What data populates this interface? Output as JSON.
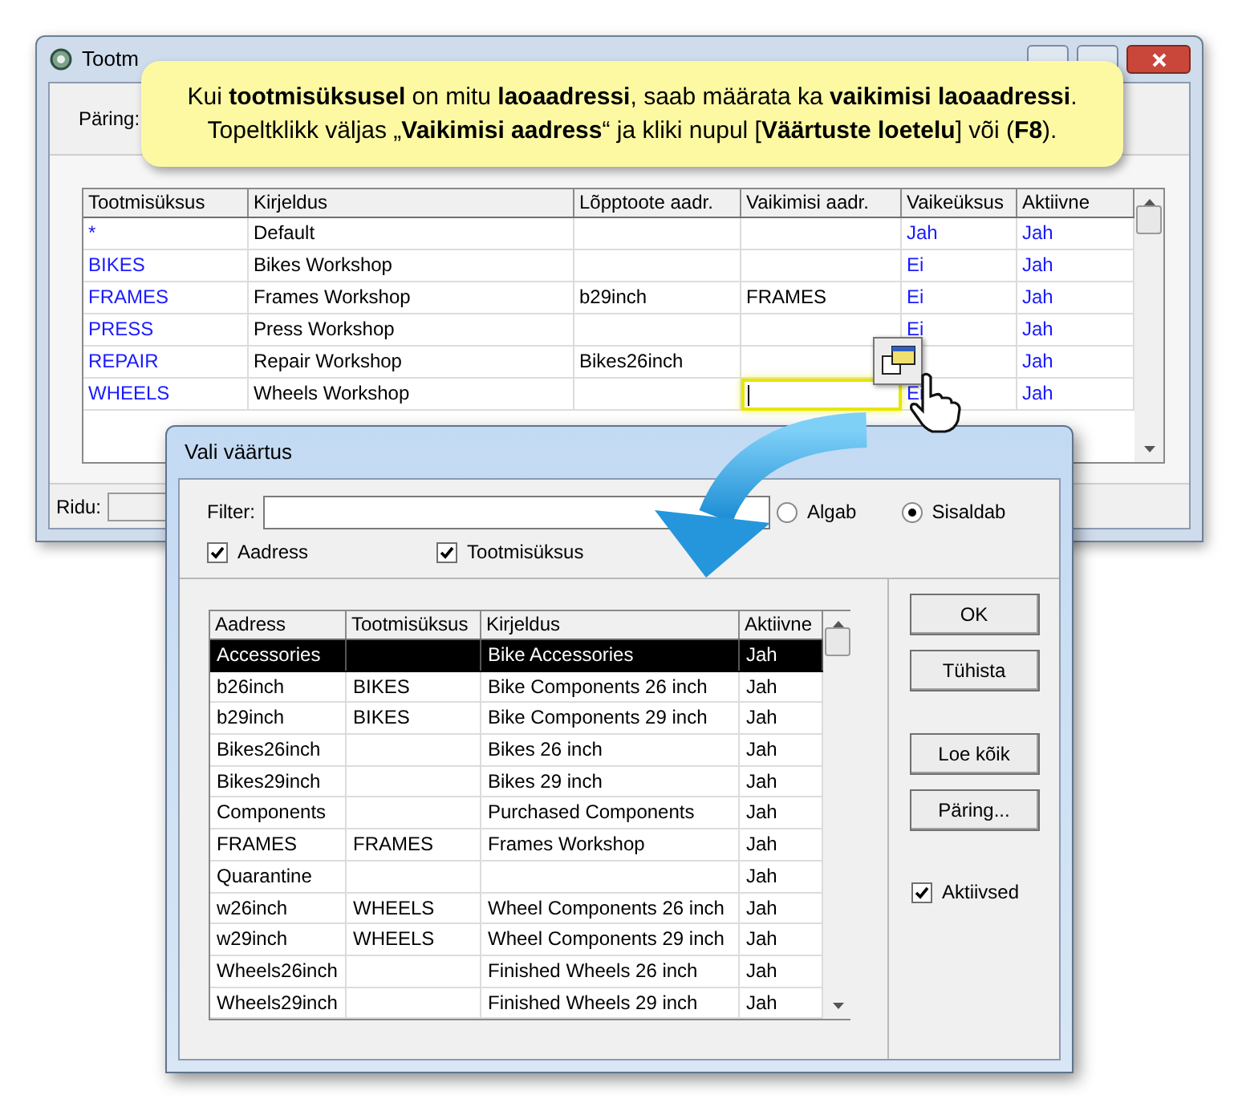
{
  "main_window": {
    "title": "Tootm",
    "query_label": "Päring:",
    "table": {
      "columns": [
        "Tootmisüksus",
        "Kirjeldus",
        "Lõpptoote aadr.",
        "Vaikimisi aadr.",
        "Vaikeüksus",
        "Aktiivne"
      ],
      "rows": [
        {
          "unit": "*",
          "description": "Default",
          "default_unit": "Jah",
          "active": "Jah",
          "editing": false
        },
        {
          "unit": "BIKES",
          "description": "Bikes Workshop",
          "default_unit": "Ei",
          "active": "Jah",
          "editing": false
        },
        {
          "unit": "FRAMES",
          "description": "Frames Workshop",
          "product_address": "b29inch",
          "default_address": "FRAMES",
          "default_unit": "Ei",
          "active": "Jah",
          "editing": false
        },
        {
          "unit": "PRESS",
          "description": "Press Workshop",
          "default_unit": "Ei",
          "active": "Jah",
          "editing": false
        },
        {
          "unit": "REPAIR",
          "description": "Repair Workshop",
          "product_address": "Bikes26inch",
          "active": "Jah",
          "editing": false
        },
        {
          "unit": "WHEELS",
          "description": "Wheels Workshop",
          "default_unit": "Ei",
          "active": "Jah",
          "editing": true
        }
      ]
    },
    "rows_label": "Ridu:"
  },
  "callout": {
    "lines": [
      "Kui **tootmisüksusel** on mitu **laoaadressi**, saab määrata ka **vaikimisi laoaadressi**.",
      "Topeltklikk väljas „**Vaikimisi aadress**“ ja kliki nupul [**Väärtuste loetelu**] või (**F8**)."
    ]
  },
  "dialog": {
    "title": "Vali väärtus",
    "filter_label": "Filter:",
    "radios": [
      {
        "label": "Algab",
        "selected": false
      },
      {
        "label": "Sisaldab",
        "selected": true
      }
    ],
    "checkboxes": [
      {
        "label": "Aadress",
        "checked": true
      },
      {
        "label": "Tootmisüksus",
        "checked": true
      }
    ],
    "table": {
      "columns": [
        "Aadress",
        "Tootmisüksus",
        "Kirjeldus",
        "Aktiivne"
      ],
      "rows": [
        {
          "address": "Accessories",
          "description": "Bike Accessories",
          "active": "Jah",
          "selected": true
        },
        {
          "address": "b26inch",
          "unit": "BIKES",
          "description": "Bike Components 26 inch",
          "active": "Jah",
          "selected": false
        },
        {
          "address": "b29inch",
          "unit": "BIKES",
          "description": "Bike Components 29 inch",
          "active": "Jah",
          "selected": false
        },
        {
          "address": "Bikes26inch",
          "description": "Bikes 26 inch",
          "active": "Jah",
          "selected": false
        },
        {
          "address": "Bikes29inch",
          "description": "Bikes 29 inch",
          "active": "Jah",
          "selected": false
        },
        {
          "address": "Components",
          "description": "Purchased Components",
          "active": "Jah",
          "selected": false
        },
        {
          "address": "FRAMES",
          "unit": "FRAMES",
          "description": "Frames Workshop",
          "active": "Jah",
          "selected": false
        },
        {
          "address": "Quarantine",
          "active": "Jah",
          "selected": false
        },
        {
          "address": "w26inch",
          "unit": "WHEELS",
          "description": "Wheel Components 26 inch",
          "active": "Jah",
          "selected": false
        },
        {
          "address": "w29inch",
          "unit": "WHEELS",
          "description": "Wheel Components 29 inch",
          "active": "Jah",
          "selected": false
        },
        {
          "address": "Wheels26inch",
          "description": "Finished Wheels 26 inch",
          "active": "Jah",
          "selected": false
        },
        {
          "address": "Wheels29inch",
          "description": "Finished Wheels 29 inch",
          "active": "Jah",
          "selected": false
        }
      ]
    },
    "buttons": [
      "OK",
      "Tühista",
      "Loe kõik",
      "Päring..."
    ],
    "active_checkbox": {
      "label": "Aktiivsed",
      "checked": true
    }
  }
}
